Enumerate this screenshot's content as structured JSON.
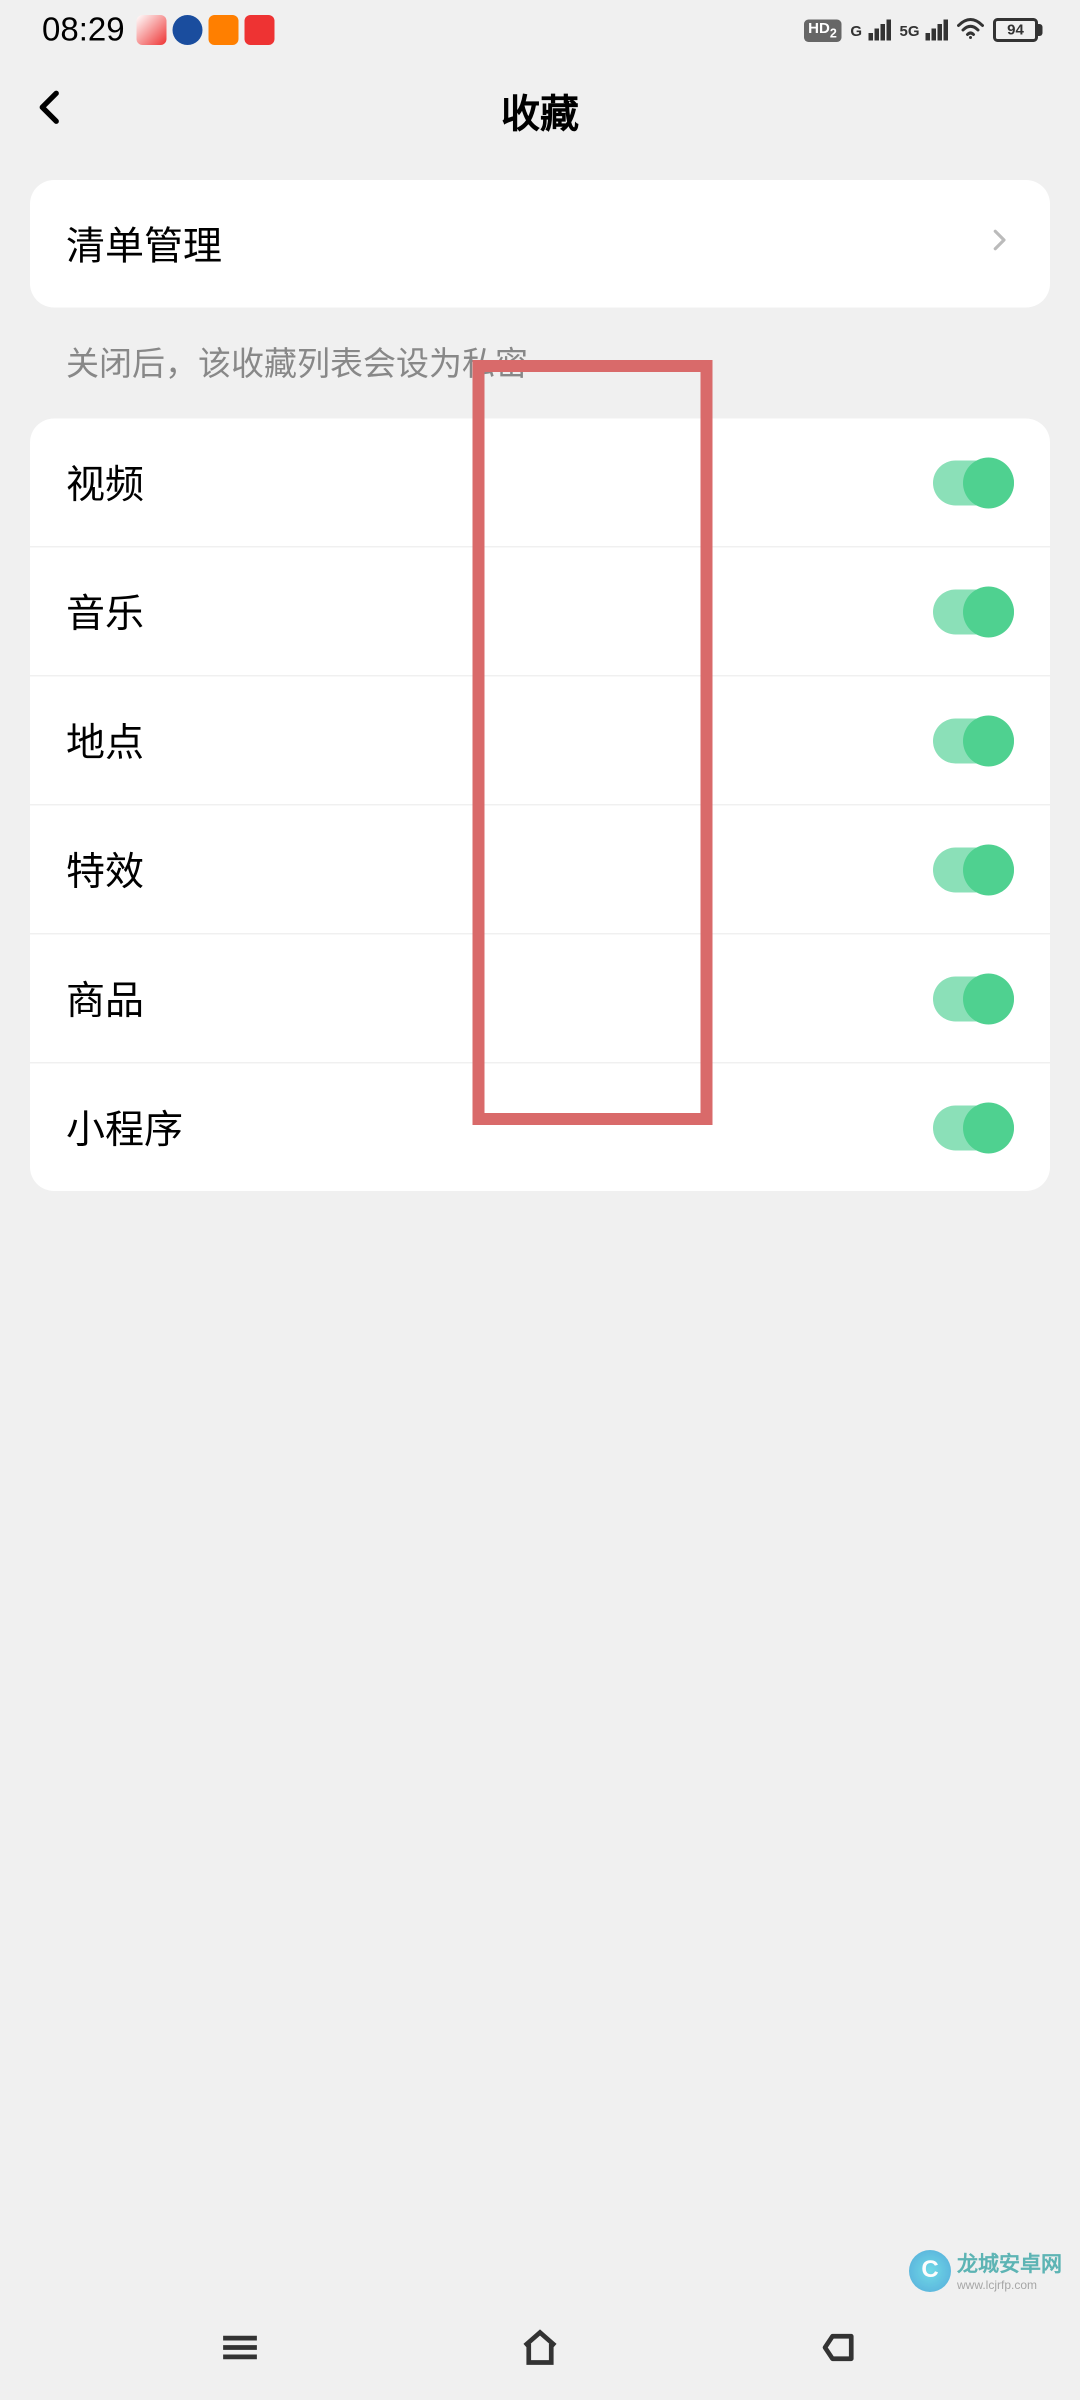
{
  "status": {
    "time": "08:29",
    "hd_label": "HD",
    "hd_sub": "2",
    "signal1_label": "G",
    "signal2_label": "5G",
    "battery_level": "94"
  },
  "header": {
    "title": "收藏"
  },
  "card1": {
    "list_manage": "清单管理"
  },
  "section_hint": "关闭后，该收藏列表会设为私密",
  "toggles": {
    "items": [
      {
        "label": "视频",
        "on": true
      },
      {
        "label": "音乐",
        "on": true
      },
      {
        "label": "地点",
        "on": true
      },
      {
        "label": "特效",
        "on": true
      },
      {
        "label": "商品",
        "on": true
      },
      {
        "label": "小程序",
        "on": true
      }
    ]
  },
  "watermark": {
    "icon_letter": "C",
    "text": "龙城安卓网",
    "sub": "www.lcjrfp.com"
  }
}
